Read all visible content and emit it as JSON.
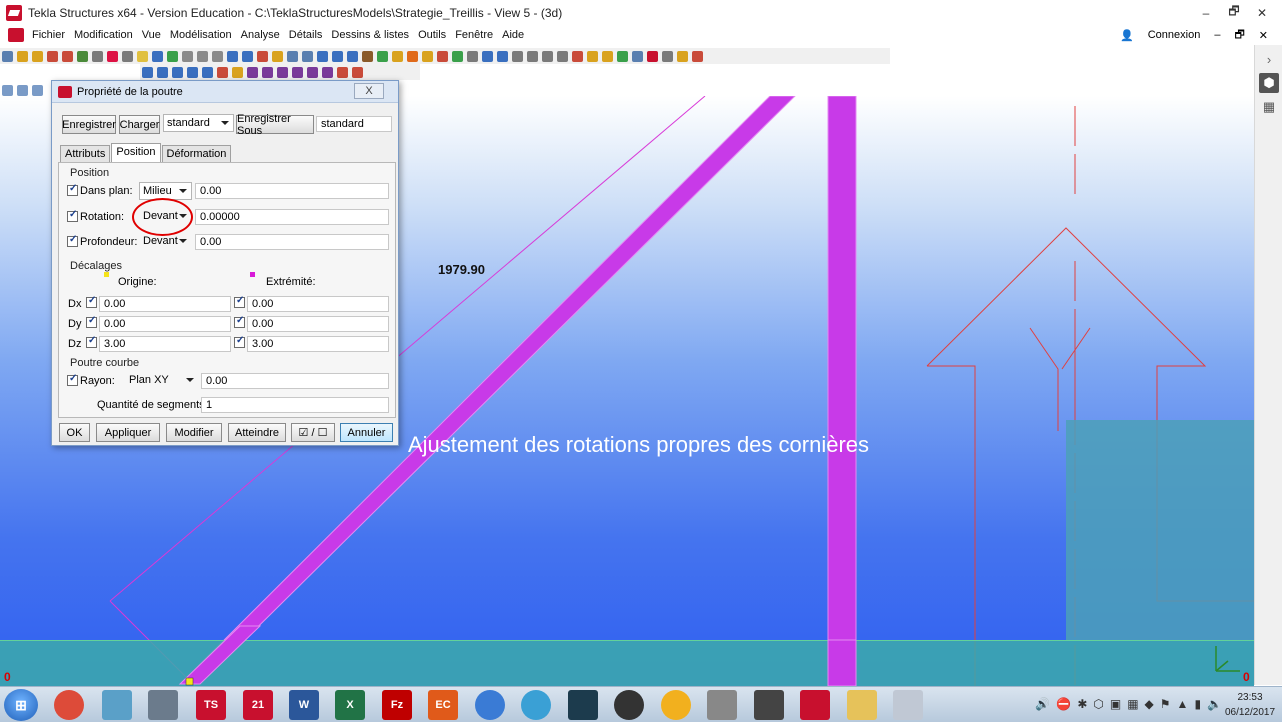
{
  "window": {
    "title": "Tekla Structures x64 - Version Education - C:\\TeklaStructuresModels\\Strategie_Treillis  - View 5 - (3d)",
    "controls": [
      "–",
      "🗗",
      "✕"
    ]
  },
  "menubar": {
    "items": [
      "Fichier",
      "Modification",
      "Vue",
      "Modélisation",
      "Analyse",
      "Détails",
      "Dessins & listes",
      "Outils",
      "Fenêtre",
      "Aide"
    ],
    "user_icon": "person-icon",
    "connexion": "Connexion",
    "controls": [
      "–",
      "🗗",
      "✕"
    ]
  },
  "side_panel": {
    "chevron": "›",
    "cube_icon": "3d-cube-icon",
    "grid_icon": "grid-plus-icon"
  },
  "viewport": {
    "dimension_label": "1979.90",
    "caption": "Ajustement des rotations propres des cornières",
    "origin_left": "0",
    "origin_right": "0"
  },
  "dialog": {
    "title": "Propriété de la poutre",
    "close": "X",
    "save_button": "Enregistrer",
    "load_button": "Charger",
    "attr_set": "standard",
    "save_as_button": "Enregistrer Sous",
    "save_as_value": "standard",
    "tabs": [
      "Attributs",
      "Position",
      "Déformation"
    ],
    "active_tab": "Position",
    "position": {
      "group_label": "Position",
      "in_plane": {
        "label": "Dans plan:",
        "option": "Milieu",
        "value": "0.00"
      },
      "rotation": {
        "label": "Rotation:",
        "option": "Devant",
        "value": "0.00000"
      },
      "depth": {
        "label": "Profondeur:",
        "option": "Devant",
        "value": "0.00"
      }
    },
    "offsets": {
      "group_label": "Décalages",
      "origin_label": "Origine:",
      "end_label": "Extrémité:",
      "origin_color": "#f5e31a",
      "end_color": "#d81ad8",
      "rows": [
        {
          "axis": "Dx",
          "origin": "0.00",
          "end": "0.00"
        },
        {
          "axis": "Dy",
          "origin": "0.00",
          "end": "0.00"
        },
        {
          "axis": "Dz",
          "origin": "3.00",
          "end": "3.00"
        }
      ]
    },
    "curved": {
      "group_label": "Poutre courbe",
      "radius_label": "Rayon:",
      "plane": "Plan XY",
      "radius_value": "0.00",
      "segments_label": "Quantité de segments:",
      "segments_value": "1"
    },
    "buttons": {
      "ok": "OK",
      "apply": "Appliquer",
      "modify": "Modifier",
      "get": "Atteindre",
      "toggle": "☑ / ☐",
      "cancel": "Annuler"
    }
  },
  "taskbar": {
    "start": "⊞",
    "apps": [
      {
        "name": "chrome-icon",
        "label": "",
        "color": "#dd4b39"
      },
      {
        "name": "files-icon",
        "label": "",
        "color": "#5aa0c8"
      },
      {
        "name": "calculator-icon",
        "label": "",
        "color": "#6b7b8c"
      },
      {
        "name": "tekla-ts-icon",
        "label": "TS",
        "color": "#c8102e"
      },
      {
        "name": "tekla-21-icon",
        "label": "21",
        "color": "#c8102e"
      },
      {
        "name": "word-icon",
        "label": "W",
        "color": "#2b579a"
      },
      {
        "name": "excel-icon",
        "label": "X",
        "color": "#217346"
      },
      {
        "name": "filezilla-icon",
        "label": "Fz",
        "color": "#bf0000"
      },
      {
        "name": "eclipse-icon",
        "label": "EC",
        "color": "#e05a1a"
      },
      {
        "name": "globe-icon",
        "label": "",
        "color": "#3a7bd5"
      },
      {
        "name": "network-icon",
        "label": "",
        "color": "#3aa0d5"
      },
      {
        "name": "terminal-icon",
        "label": "",
        "color": "#1c3b4d"
      },
      {
        "name": "headphones-icon",
        "label": "",
        "color": "#333333"
      },
      {
        "name": "emoji-icon",
        "label": "",
        "color": "#f2b01e"
      },
      {
        "name": "camera-icon",
        "label": "",
        "color": "#888888"
      },
      {
        "name": "media-icon",
        "label": "",
        "color": "#444444"
      },
      {
        "name": "hilti-icon",
        "label": "",
        "color": "#c8102e"
      },
      {
        "name": "folder-icon",
        "label": "",
        "color": "#e6c25a"
      },
      {
        "name": "snipping-icon",
        "label": "",
        "color": "#c0c8d4"
      }
    ],
    "tray_icons": [
      "🔊",
      "⛔",
      "✱",
      "⬡",
      "▣",
      "▦",
      "◆",
      "⚑",
      "▲",
      "▮",
      "🔈"
    ],
    "time": "23:53",
    "date": "06/12/2017"
  }
}
